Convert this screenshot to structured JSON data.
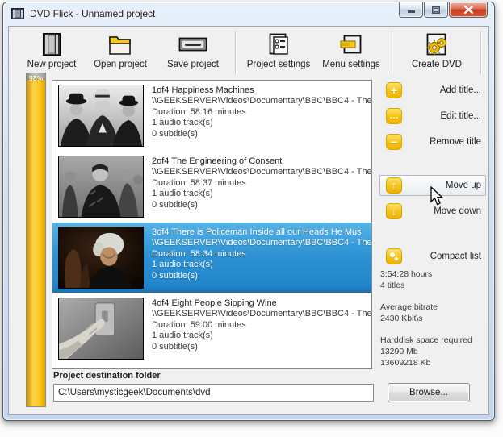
{
  "window": {
    "title": "DVD Flick - Unnamed project",
    "controls": [
      "minimize",
      "maximize",
      "close"
    ]
  },
  "colors": {
    "accent_yellow": "#f6c51d",
    "selection_blue": "#2e93d5",
    "capacity_fill": "#fdc71e",
    "close_red": "#c23a22"
  },
  "toolbar": {
    "items": [
      {
        "label": "New project",
        "icon": "filmstrip-icon"
      },
      {
        "label": "Open project",
        "icon": "open-folder-icon"
      },
      {
        "label": "Save project",
        "icon": "disk-drive-icon"
      },
      {
        "label": "Project settings",
        "icon": "settings-list-icon"
      },
      {
        "label": "Menu settings",
        "icon": "menu-window-icon"
      },
      {
        "label": "Create DVD",
        "icon": "gears-icon"
      }
    ]
  },
  "capacity": {
    "percent_label": "98%"
  },
  "titles": [
    {
      "name": "1of4 Happiness Machines",
      "path": "\\\\GEEKSERVER\\Videos\\Documentary\\BBC\\BBC4 - The",
      "duration": "Duration: 58:16 minutes",
      "audio": "1 audio track(s)",
      "subtitles": "0 subtitle(s)",
      "selected": false
    },
    {
      "name": "2of4 The Engineering of Consent",
      "path": "\\\\GEEKSERVER\\Videos\\Documentary\\BBC\\BBC4 - The",
      "duration": "Duration: 58:37 minutes",
      "audio": "1 audio track(s)",
      "subtitles": "0 subtitle(s)",
      "selected": false
    },
    {
      "name": "3of4 There is Policeman Inside all our Heads He Mus",
      "path": "\\\\GEEKSERVER\\Videos\\Documentary\\BBC\\BBC4 - The",
      "duration": "Duration: 58:34 minutes",
      "audio": "1 audio track(s)",
      "subtitles": "0 subtitle(s)",
      "selected": true
    },
    {
      "name": "4of4 Eight People Sipping Wine",
      "path": "\\\\GEEKSERVER\\Videos\\Documentary\\BBC\\BBC4 - The",
      "duration": "Duration: 59:00 minutes",
      "audio": "1 audio track(s)",
      "subtitles": "0 subtitle(s)",
      "selected": false
    }
  ],
  "actions": {
    "add": "Add title...",
    "edit": "Edit title...",
    "remove": "Remove title",
    "move_up": "Move up",
    "move_down": "Move down",
    "compact": "Compact list"
  },
  "stats": {
    "total_time": "3:54:28 hours",
    "title_count": "4 titles",
    "bitrate_label": "Average bitrate",
    "bitrate_value": "2430 Kbit\\s",
    "space_label": "Harddisk space required",
    "space_mb": "13290 Mb",
    "space_kb": "13609218 Kb"
  },
  "destination": {
    "label": "Project destination folder",
    "path": "C:\\Users\\mysticgeek\\Documents\\dvd",
    "browse_label": "Browse..."
  }
}
